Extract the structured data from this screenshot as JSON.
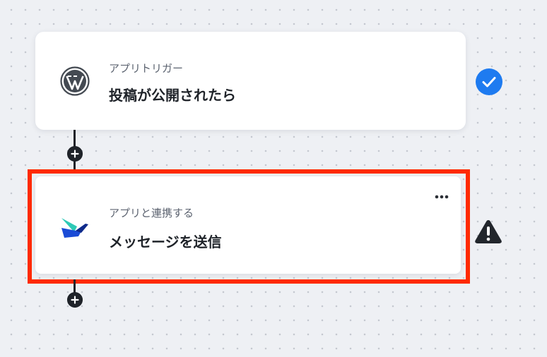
{
  "steps": [
    {
      "subtitle": "アプリトリガー",
      "title": "投稿が公開されたら",
      "app_icon": "wordpress-icon",
      "status_icon": "check-circle-icon"
    },
    {
      "subtitle": "アプリと連携する",
      "title": "メッセージを送信",
      "app_icon": "bird-logo-icon",
      "status_icon": "warning-triangle-icon"
    }
  ],
  "colors": {
    "highlight": "#ff2a00",
    "success": "#1e7bf0",
    "text_dark": "#1f2329",
    "text_muted": "#5c6370"
  }
}
